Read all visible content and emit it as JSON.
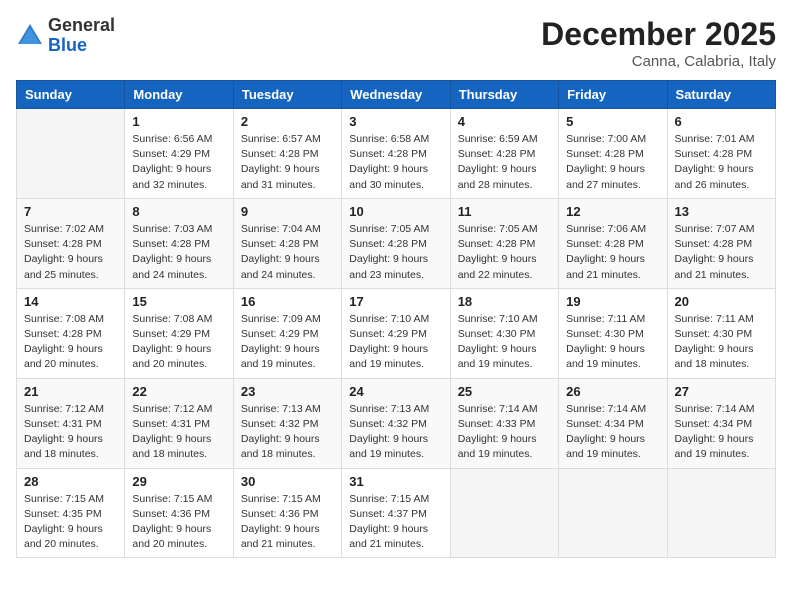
{
  "header": {
    "logo_general": "General",
    "logo_blue": "Blue",
    "month": "December 2025",
    "location": "Canna, Calabria, Italy"
  },
  "weekdays": [
    "Sunday",
    "Monday",
    "Tuesday",
    "Wednesday",
    "Thursday",
    "Friday",
    "Saturday"
  ],
  "weeks": [
    [
      {
        "day": "",
        "sunrise": "",
        "sunset": "",
        "daylight": ""
      },
      {
        "day": "1",
        "sunrise": "Sunrise: 6:56 AM",
        "sunset": "Sunset: 4:29 PM",
        "daylight": "Daylight: 9 hours and 32 minutes."
      },
      {
        "day": "2",
        "sunrise": "Sunrise: 6:57 AM",
        "sunset": "Sunset: 4:28 PM",
        "daylight": "Daylight: 9 hours and 31 minutes."
      },
      {
        "day": "3",
        "sunrise": "Sunrise: 6:58 AM",
        "sunset": "Sunset: 4:28 PM",
        "daylight": "Daylight: 9 hours and 30 minutes."
      },
      {
        "day": "4",
        "sunrise": "Sunrise: 6:59 AM",
        "sunset": "Sunset: 4:28 PM",
        "daylight": "Daylight: 9 hours and 28 minutes."
      },
      {
        "day": "5",
        "sunrise": "Sunrise: 7:00 AM",
        "sunset": "Sunset: 4:28 PM",
        "daylight": "Daylight: 9 hours and 27 minutes."
      },
      {
        "day": "6",
        "sunrise": "Sunrise: 7:01 AM",
        "sunset": "Sunset: 4:28 PM",
        "daylight": "Daylight: 9 hours and 26 minutes."
      }
    ],
    [
      {
        "day": "7",
        "sunrise": "Sunrise: 7:02 AM",
        "sunset": "Sunset: 4:28 PM",
        "daylight": "Daylight: 9 hours and 25 minutes."
      },
      {
        "day": "8",
        "sunrise": "Sunrise: 7:03 AM",
        "sunset": "Sunset: 4:28 PM",
        "daylight": "Daylight: 9 hours and 24 minutes."
      },
      {
        "day": "9",
        "sunrise": "Sunrise: 7:04 AM",
        "sunset": "Sunset: 4:28 PM",
        "daylight": "Daylight: 9 hours and 24 minutes."
      },
      {
        "day": "10",
        "sunrise": "Sunrise: 7:05 AM",
        "sunset": "Sunset: 4:28 PM",
        "daylight": "Daylight: 9 hours and 23 minutes."
      },
      {
        "day": "11",
        "sunrise": "Sunrise: 7:05 AM",
        "sunset": "Sunset: 4:28 PM",
        "daylight": "Daylight: 9 hours and 22 minutes."
      },
      {
        "day": "12",
        "sunrise": "Sunrise: 7:06 AM",
        "sunset": "Sunset: 4:28 PM",
        "daylight": "Daylight: 9 hours and 21 minutes."
      },
      {
        "day": "13",
        "sunrise": "Sunrise: 7:07 AM",
        "sunset": "Sunset: 4:28 PM",
        "daylight": "Daylight: 9 hours and 21 minutes."
      }
    ],
    [
      {
        "day": "14",
        "sunrise": "Sunrise: 7:08 AM",
        "sunset": "Sunset: 4:28 PM",
        "daylight": "Daylight: 9 hours and 20 minutes."
      },
      {
        "day": "15",
        "sunrise": "Sunrise: 7:08 AM",
        "sunset": "Sunset: 4:29 PM",
        "daylight": "Daylight: 9 hours and 20 minutes."
      },
      {
        "day": "16",
        "sunrise": "Sunrise: 7:09 AM",
        "sunset": "Sunset: 4:29 PM",
        "daylight": "Daylight: 9 hours and 19 minutes."
      },
      {
        "day": "17",
        "sunrise": "Sunrise: 7:10 AM",
        "sunset": "Sunset: 4:29 PM",
        "daylight": "Daylight: 9 hours and 19 minutes."
      },
      {
        "day": "18",
        "sunrise": "Sunrise: 7:10 AM",
        "sunset": "Sunset: 4:30 PM",
        "daylight": "Daylight: 9 hours and 19 minutes."
      },
      {
        "day": "19",
        "sunrise": "Sunrise: 7:11 AM",
        "sunset": "Sunset: 4:30 PM",
        "daylight": "Daylight: 9 hours and 19 minutes."
      },
      {
        "day": "20",
        "sunrise": "Sunrise: 7:11 AM",
        "sunset": "Sunset: 4:30 PM",
        "daylight": "Daylight: 9 hours and 18 minutes."
      }
    ],
    [
      {
        "day": "21",
        "sunrise": "Sunrise: 7:12 AM",
        "sunset": "Sunset: 4:31 PM",
        "daylight": "Daylight: 9 hours and 18 minutes."
      },
      {
        "day": "22",
        "sunrise": "Sunrise: 7:12 AM",
        "sunset": "Sunset: 4:31 PM",
        "daylight": "Daylight: 9 hours and 18 minutes."
      },
      {
        "day": "23",
        "sunrise": "Sunrise: 7:13 AM",
        "sunset": "Sunset: 4:32 PM",
        "daylight": "Daylight: 9 hours and 18 minutes."
      },
      {
        "day": "24",
        "sunrise": "Sunrise: 7:13 AM",
        "sunset": "Sunset: 4:32 PM",
        "daylight": "Daylight: 9 hours and 19 minutes."
      },
      {
        "day": "25",
        "sunrise": "Sunrise: 7:14 AM",
        "sunset": "Sunset: 4:33 PM",
        "daylight": "Daylight: 9 hours and 19 minutes."
      },
      {
        "day": "26",
        "sunrise": "Sunrise: 7:14 AM",
        "sunset": "Sunset: 4:34 PM",
        "daylight": "Daylight: 9 hours and 19 minutes."
      },
      {
        "day": "27",
        "sunrise": "Sunrise: 7:14 AM",
        "sunset": "Sunset: 4:34 PM",
        "daylight": "Daylight: 9 hours and 19 minutes."
      }
    ],
    [
      {
        "day": "28",
        "sunrise": "Sunrise: 7:15 AM",
        "sunset": "Sunset: 4:35 PM",
        "daylight": "Daylight: 9 hours and 20 minutes."
      },
      {
        "day": "29",
        "sunrise": "Sunrise: 7:15 AM",
        "sunset": "Sunset: 4:36 PM",
        "daylight": "Daylight: 9 hours and 20 minutes."
      },
      {
        "day": "30",
        "sunrise": "Sunrise: 7:15 AM",
        "sunset": "Sunset: 4:36 PM",
        "daylight": "Daylight: 9 hours and 21 minutes."
      },
      {
        "day": "31",
        "sunrise": "Sunrise: 7:15 AM",
        "sunset": "Sunset: 4:37 PM",
        "daylight": "Daylight: 9 hours and 21 minutes."
      },
      {
        "day": "",
        "sunrise": "",
        "sunset": "",
        "daylight": ""
      },
      {
        "day": "",
        "sunrise": "",
        "sunset": "",
        "daylight": ""
      },
      {
        "day": "",
        "sunrise": "",
        "sunset": "",
        "daylight": ""
      }
    ]
  ]
}
